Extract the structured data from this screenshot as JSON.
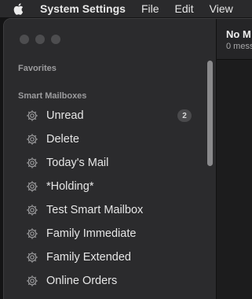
{
  "menubar": {
    "apple_icon": "apple-logo-icon",
    "items": [
      "System Settings",
      "File",
      "Edit",
      "View"
    ]
  },
  "sidebar": {
    "sections": {
      "favorites": "Favorites",
      "smart_mailboxes": "Smart Mailboxes"
    },
    "smart_mailboxes": [
      {
        "label": "Unread",
        "badge": "2",
        "icon": "gear-icon"
      },
      {
        "label": "Delete",
        "icon": "gear-icon"
      },
      {
        "label": "Today's Mail",
        "icon": "gear-icon"
      },
      {
        "label": "*Holding*",
        "icon": "gear-icon"
      },
      {
        "label": "Test Smart Mailbox",
        "icon": "gear-icon"
      },
      {
        "label": "Family Immediate",
        "icon": "gear-icon"
      },
      {
        "label": "Family Extended",
        "icon": "gear-icon"
      },
      {
        "label": "Online Orders",
        "icon": "gear-icon"
      }
    ]
  },
  "content": {
    "title": "No M",
    "subtitle": "0 mess"
  },
  "colors": {
    "menubar_bg": "#2a2a2c",
    "sidebar_bg": "#2b2b2d",
    "text": "#e6e6e6",
    "section_header": "#9c9c9e"
  }
}
